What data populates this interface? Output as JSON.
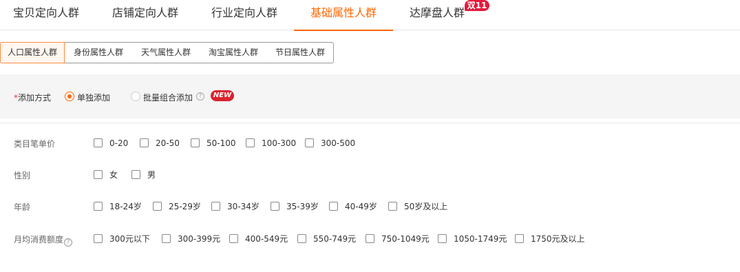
{
  "top_tabs": [
    "宝贝定向人群",
    "店铺定向人群",
    "行业定向人群",
    "基础属性人群",
    "达摩盘人群"
  ],
  "top_tab_active": 3,
  "top_badge": "双11",
  "sub_tabs": [
    "人口属性人群",
    "身份属性人群",
    "天气属性人群",
    "淘宝属性人群",
    "节日属性人群"
  ],
  "sub_tab_active": 0,
  "method": {
    "required_mark": "*",
    "label": "添加方式",
    "option_single": "单独添加",
    "option_batch": "批量组合添加",
    "help": "?",
    "new_badge": "NEW",
    "selected": "单独添加"
  },
  "filters": {
    "price": {
      "label": "类目笔单价",
      "options": [
        "0-20",
        "20-50",
        "50-100",
        "100-300",
        "300-500"
      ]
    },
    "gender": {
      "label": "性别",
      "options": [
        "女",
        "男"
      ]
    },
    "age": {
      "label": "年龄",
      "options": [
        "18-24岁",
        "25-29岁",
        "30-34岁",
        "35-39岁",
        "40-49岁",
        "50岁及以上"
      ]
    },
    "spend": {
      "label": "月均消费额度",
      "help": "?",
      "options": [
        "300元以下",
        "300-399元",
        "400-549元",
        "550-749元",
        "750-1049元",
        "1050-1749元",
        "1750元及以上"
      ]
    }
  },
  "colors": {
    "accent": "#ff6600",
    "badge_red": "#e4193d",
    "bar_bg": "#f5f5f5"
  }
}
